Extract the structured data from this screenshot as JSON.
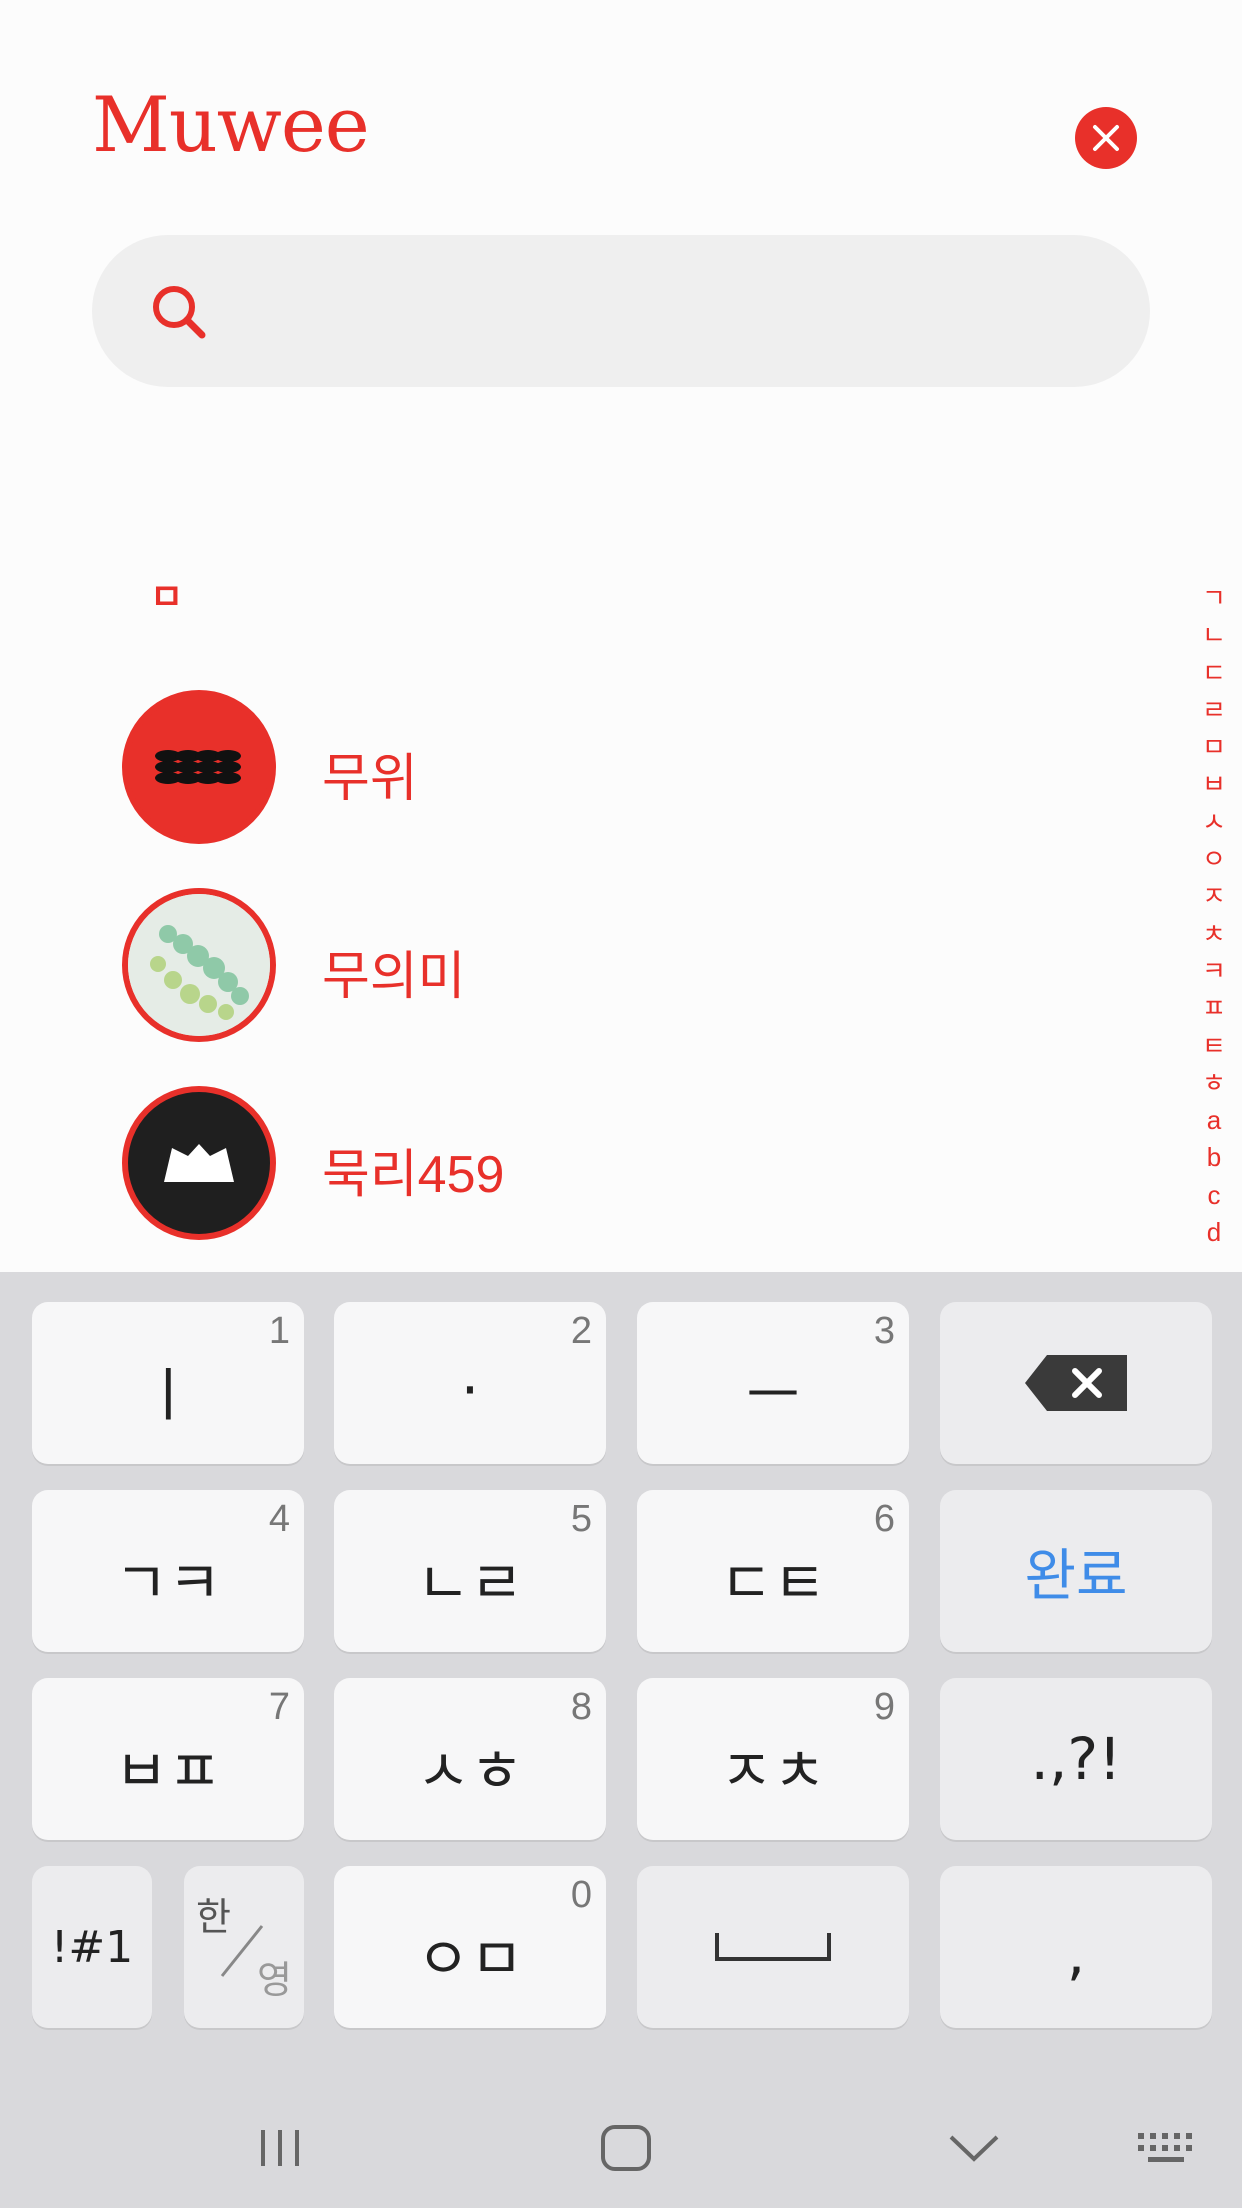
{
  "app": {
    "title": "Muwee"
  },
  "search": {
    "placeholder": "",
    "value": ""
  },
  "section": {
    "header": "ㅁ"
  },
  "list": [
    {
      "name": "무위"
    },
    {
      "name": "무의미"
    },
    {
      "name": "묵리459"
    }
  ],
  "index_letters": [
    "ㄱ",
    "ㄴ",
    "ㄷ",
    "ㄹ",
    "ㅁ",
    "ㅂ",
    "ㅅ",
    "ㅇ",
    "ㅈ",
    "ㅊ",
    "ㅋ",
    "ㅍ",
    "ㅌ",
    "ㅎ",
    "a",
    "b",
    "c",
    "d"
  ],
  "keyboard": {
    "row1": [
      {
        "label": "ㅣ",
        "num": "1"
      },
      {
        "label": "·",
        "num": "2"
      },
      {
        "label": "ㅡ",
        "num": "3"
      }
    ],
    "row2": [
      {
        "label": "ㄱㅋ",
        "num": "4"
      },
      {
        "label": "ㄴㄹ",
        "num": "5"
      },
      {
        "label": "ㄷㅌ",
        "num": "6"
      }
    ],
    "row3": [
      {
        "label": "ㅂㅍ",
        "num": "7"
      },
      {
        "label": "ㅅㅎ",
        "num": "8"
      },
      {
        "label": "ㅈㅊ",
        "num": "9"
      }
    ],
    "done": "완료",
    "punct": ".,?!",
    "symbols": "!#1",
    "lang_top": "한",
    "lang_bottom": "영",
    "zero_key": {
      "label": "ㅇㅁ",
      "num": "0"
    },
    "comma": ","
  },
  "colors": {
    "accent": "#e8302a",
    "keyboard_bg": "#d9d9dc",
    "done_blue": "#3f8ce8"
  }
}
